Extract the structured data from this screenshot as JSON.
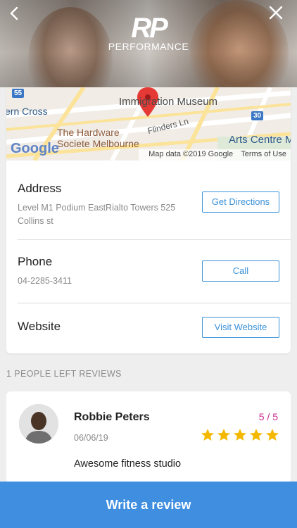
{
  "header": {
    "logo_mark": "RP",
    "logo_sub": "PERFORMANCE",
    "back_icon": "chevron-left-icon",
    "close_icon": "close-icon"
  },
  "map": {
    "labels": {
      "museum": "Immigration Museum",
      "ern_cross": "ern Cross",
      "hardware": "The Hardware",
      "societe": "Societe Melbourne",
      "flinders": "Flinders Ln",
      "arts": "Arts Centre M"
    },
    "badges": [
      "55",
      "30"
    ],
    "google": "Google",
    "map_data": "Map data ©2019 Google",
    "terms": "Terms of Use"
  },
  "info": {
    "address_label": "Address",
    "address_value": "Level M1 Podium EastRialto Towers 525 Collins st",
    "directions_button": "Get Directions",
    "phone_label": "Phone",
    "phone_value": "04-2285-3411",
    "call_button": "Call",
    "website_label": "Website",
    "website_button": "Visit Website"
  },
  "reviews": {
    "section_title": "1 PEOPLE LEFT REVIEWS",
    "items": [
      {
        "name": "Robbie Peters",
        "date": "06/06/19",
        "score": "5 / 5",
        "stars": 5,
        "text": "Awesome fitness studio"
      }
    ]
  },
  "cta": {
    "label": "Write a review"
  },
  "colors": {
    "accent": "#3f8ee0",
    "score": "#c72b8f",
    "star": "#f5b800"
  }
}
